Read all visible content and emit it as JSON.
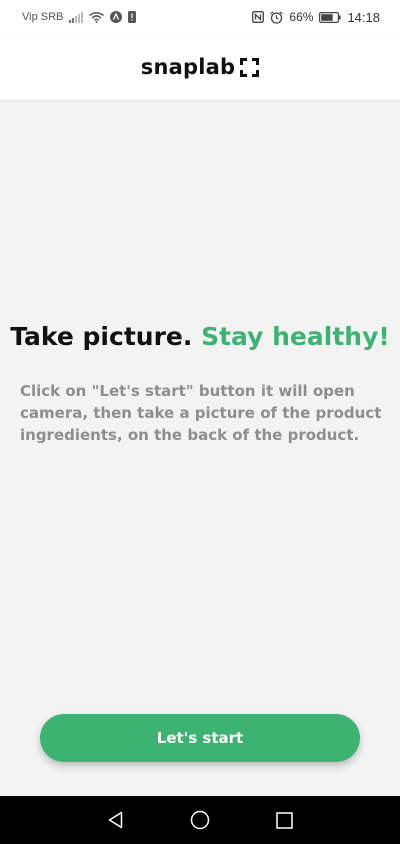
{
  "status_bar": {
    "carrier": "Vip SRB",
    "battery_percent": "66%",
    "time": "14:18",
    "icons": [
      "signal-icon",
      "wifi-icon",
      "notification-a-icon",
      "notification-alert-icon",
      "nfc-icon",
      "alarm-icon",
      "battery-icon"
    ]
  },
  "header": {
    "logo_text": "snaplab",
    "logo_icon": "scan-frame-icon"
  },
  "main": {
    "headline_part1": "Take picture.",
    "headline_part2": "Stay healthy!",
    "description": "Click on \"Let's start\" button it will open camera, then take a picture of the product ingredients, on the back of the product."
  },
  "actions": {
    "start_label": "Let's start"
  },
  "nav_bar": {
    "buttons": [
      "back-icon",
      "home-icon",
      "recents-icon"
    ]
  },
  "colors": {
    "accent": "#3cb371",
    "background": "#f3f3f3",
    "description_text": "#8e8e8e"
  }
}
